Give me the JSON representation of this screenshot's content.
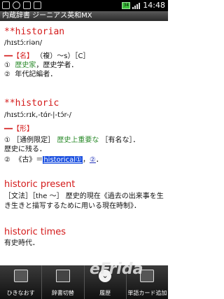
{
  "status": {
    "battery_label": "34",
    "time": "14:48"
  },
  "title": "内蔵辞書 ジーニアス英和MX",
  "entries": [
    {
      "headword": "**historian",
      "pron": "/hɪstɔ́ːriən/",
      "pos": "━━【名】",
      "line1": "①（複）～s）［C］",
      "sense1_num": "①",
      "sense1_green": "歴史家",
      "sense1_rest": "，歴史学者．",
      "sense2_num": "②",
      "sense2_text": "年代記編者．"
    },
    {
      "headword": "**historic",
      "pron": "/hɪstɔ́ːrɪk,-tɑ́r-|-tɔ́r-/",
      "pos": "━━【形】",
      "s1_num": "①",
      "s1_a": "［通例限定］",
      "s1_green": "歴史上重要な",
      "s1_b": "［有名な］．",
      "s1_cont": "歴史に残る．",
      "s2_num": "②",
      "s2_a": "《古》＝",
      "s2_hl": "historical①",
      "s2_sep": "，",
      "s2_link": "②",
      "s2_end": "．"
    },
    {
      "headword": "historic present",
      "text": "［文法］［the ～］ 歴史的現在《過去の出来事を生き生きと描写するために用いる現在時制》．"
    },
    {
      "headword": "historic times",
      "text": "有史時代．"
    }
  ],
  "toolbar": {
    "back_label": "ひきなおす",
    "dict_switch_label": "辞書切替",
    "history_label": "履歴",
    "card_label": "単語カード追加"
  },
  "watermark": "eFrida"
}
